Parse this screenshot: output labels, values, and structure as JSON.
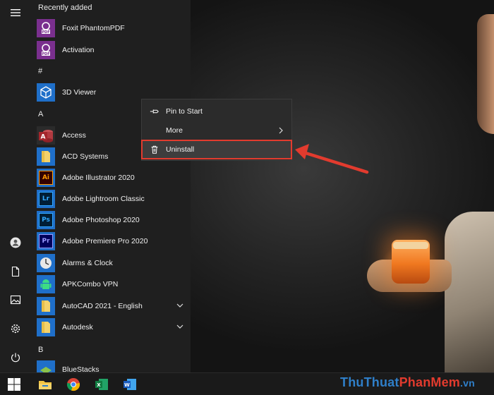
{
  "start_menu": {
    "rail": {
      "menu_icon": "hamburger-icon",
      "user_icon": "user-icon",
      "documents_icon": "document-icon",
      "pictures_icon": "pictures-icon",
      "settings_icon": "gear-icon",
      "power_icon": "power-icon"
    },
    "sections": {
      "recent": "Recently added",
      "hash": "#",
      "a": "A",
      "b": "B"
    },
    "apps": [
      {
        "label": "Foxit PhantomPDF",
        "tile_color": "#7a2f8e",
        "tile_text": "PDF"
      },
      {
        "label": "Activation",
        "tile_color": "#7a2f8e",
        "tile_text": "PDF"
      },
      {
        "label": "3D Viewer",
        "tile_color": "#1f6fc9",
        "icon": "cube-icon"
      },
      {
        "label": "Access",
        "tile_color": "#a4262c",
        "tile_text": "A"
      },
      {
        "label": "ACD Systems",
        "tile_color": "#1f6fc9",
        "icon": "folder-icon"
      },
      {
        "label": "Adobe Illustrator 2020",
        "tile_color": "#330000",
        "tile_text": "Ai",
        "text_color": "#ff9a00"
      },
      {
        "label": "Adobe Lightroom Classic",
        "tile_color": "#001e36",
        "tile_text": "Lr",
        "text_color": "#31a8ff"
      },
      {
        "label": "Adobe Photoshop 2020",
        "tile_color": "#001e36",
        "tile_text": "Ps",
        "text_color": "#31a8ff"
      },
      {
        "label": "Adobe Premiere Pro 2020",
        "tile_color": "#00005b",
        "tile_text": "Pr",
        "text_color": "#9999ff"
      },
      {
        "label": "Alarms & Clock",
        "tile_color": "#1f6fc9",
        "icon": "clock-icon"
      },
      {
        "label": "APKCombo VPN",
        "tile_color": "#1f6fc9",
        "icon": "android-icon"
      },
      {
        "label": "AutoCAD 2021 - English",
        "tile_color": "#1f6fc9",
        "icon": "folder-icon",
        "expandable": true
      },
      {
        "label": "Autodesk",
        "tile_color": "#1f6fc9",
        "icon": "folder-icon",
        "expandable": true
      },
      {
        "label": "BlueStacks",
        "tile_color": "#1f6fc9",
        "icon": "bluestacks-icon"
      }
    ]
  },
  "context_menu": {
    "items": [
      {
        "label": "Pin to Start",
        "icon": "pin-icon"
      },
      {
        "label": "More",
        "icon": "",
        "submenu": true
      },
      {
        "label": "Uninstall",
        "icon": "trash-icon",
        "highlighted": true
      }
    ]
  },
  "taskbar": {
    "start_icon": "windows-icon",
    "pinned": [
      "file-explorer-icon",
      "chrome-icon",
      "excel-icon",
      "word-icon"
    ]
  },
  "watermark": {
    "part1": "ThuThuat",
    "part2": "PhanMem",
    "part3": ".vn"
  },
  "colors": {
    "menu_bg": "#1f1f1f",
    "accent_blue": "#1f6fc9",
    "highlight_red": "#e23b2e"
  }
}
